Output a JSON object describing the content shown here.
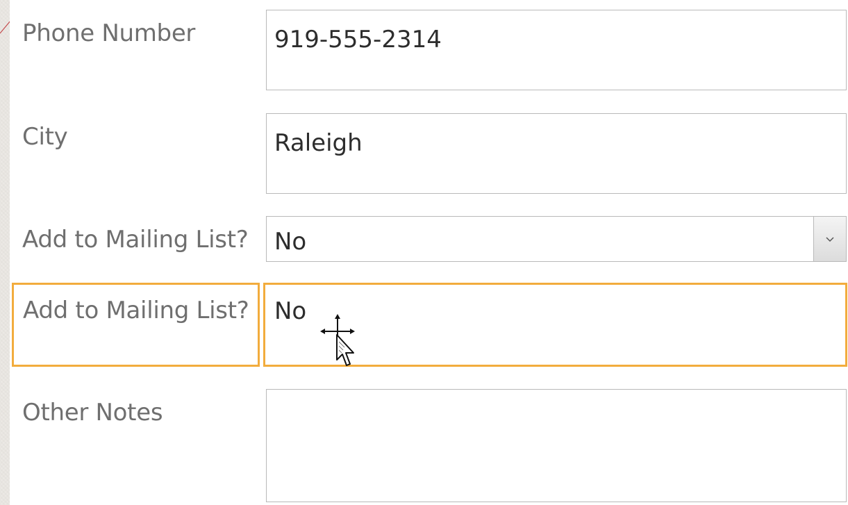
{
  "form": {
    "phone": {
      "label": "Phone Number",
      "value": "919-555-2314"
    },
    "city": {
      "label": "City",
      "value": "Raleigh"
    },
    "mailing_combo": {
      "label": "Add to Mailing List?",
      "value": "No"
    },
    "mailing_selected": {
      "label": "Add to Mailing List?",
      "value": "No"
    },
    "notes": {
      "label": "Other Notes",
      "value": ""
    }
  },
  "icons": {
    "dropdown": "chevron-down-icon",
    "cursor": "move-cursor-icon"
  },
  "colors": {
    "selection_outline": "#f2ac3d",
    "label_text": "#6f6f6f",
    "field_text": "#2d2d2d",
    "field_border": "#b9b9b9"
  }
}
